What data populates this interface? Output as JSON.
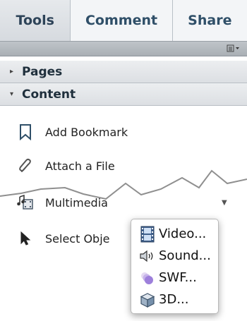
{
  "tabs": [
    {
      "label": "Tools",
      "active": true
    },
    {
      "label": "Comment",
      "active": false
    },
    {
      "label": "Share",
      "active": false
    }
  ],
  "toolbar": {
    "options_icon": "panel-options-icon"
  },
  "sections": {
    "pages": {
      "label": "Pages",
      "expanded": false
    },
    "content": {
      "label": "Content",
      "expanded": true
    }
  },
  "content_items": {
    "add_bookmark": {
      "label": "Add Bookmark",
      "icon": "bookmark-icon"
    },
    "attach_file": {
      "label": "Attach a File",
      "icon": "paperclip-icon"
    },
    "multimedia": {
      "label": "Multimedia",
      "icon": "multimedia-icon"
    },
    "select_object": {
      "label": "Select Obje",
      "icon": "arrow-cursor-icon"
    }
  },
  "multimedia_menu": [
    {
      "label": "Video...",
      "icon": "film-icon"
    },
    {
      "label": "Sound...",
      "icon": "speaker-icon"
    },
    {
      "label": "SWF...",
      "icon": "swf-icon"
    },
    {
      "label": "3D...",
      "icon": "cube-icon"
    }
  ],
  "colors": {
    "tab_text": "#2f4f68",
    "header_bg": "#dcdfe3",
    "strip": "#a9afb5"
  }
}
